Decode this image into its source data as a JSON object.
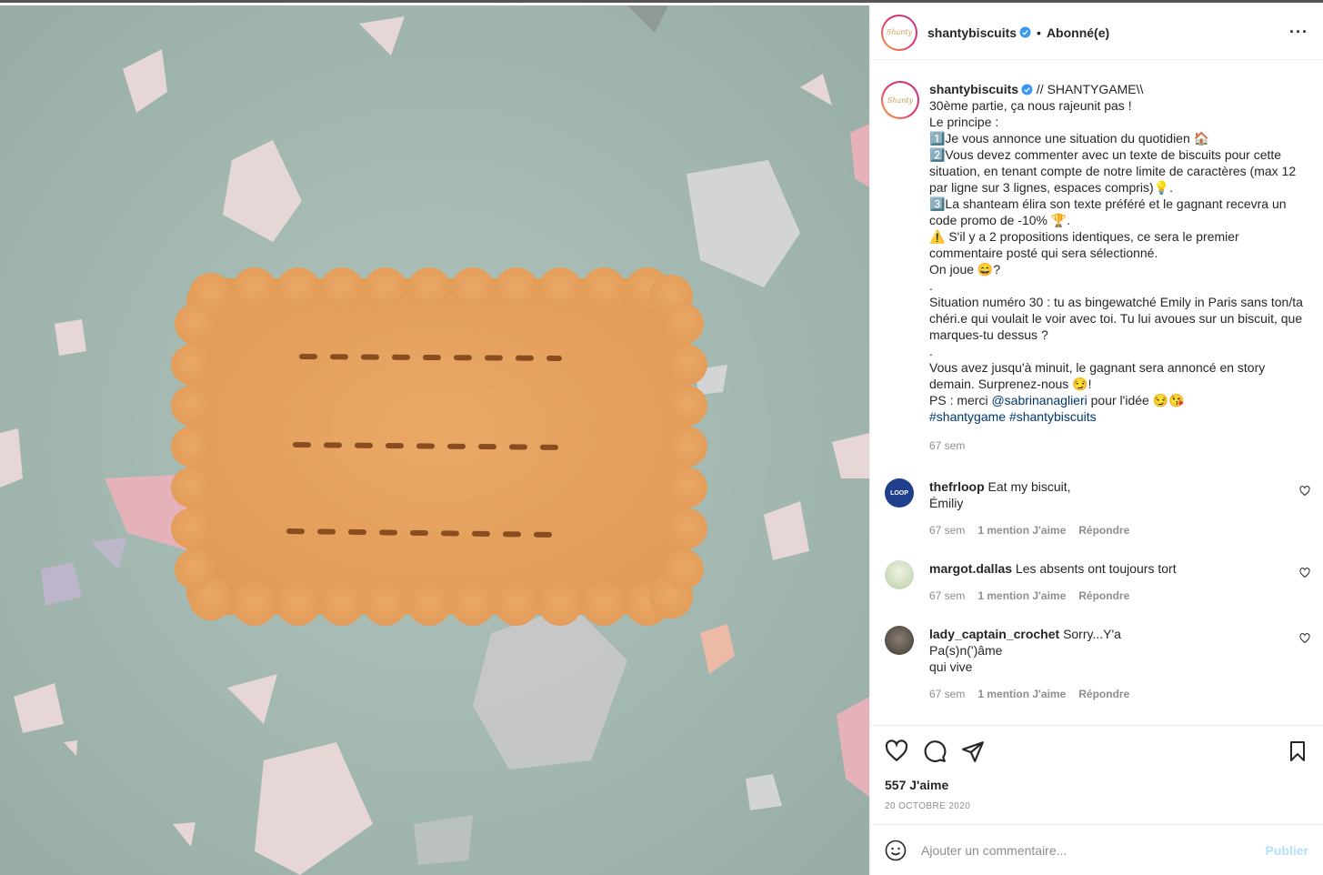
{
  "post": {
    "author": "shantybiscuits",
    "logo_text": "Shanty",
    "follow_status": "Abonné(e)",
    "dot": "•",
    "more": "···",
    "caption_lines": [
      "// SHANTYGAME\\\\",
      "30ème partie, ça nous rajeunit pas !",
      "Le principe :",
      "1️⃣Je vous annonce une situation du quotidien 🏠",
      "2️⃣Vous devez commenter avec un texte de biscuits pour cette situation, en tenant compte de notre limite de caractères (max 12 par ligne sur 3 lignes, espaces compris)💡.",
      "3️⃣La shanteam élira son texte préféré et le gagnant recevra un code promo de -10% 🏆.",
      "⚠️ S'il y a 2 propositions identiques, ce sera le premier commentaire posté qui sera sélectionné.",
      "On joue 😄?",
      ".",
      "Situation numéro 30 : tu as bingewatché Emily in Paris sans ton/ta chéri.e qui voulait le voir avec toi. Tu lui avoues sur un biscuit, que marques-tu dessus ?",
      ".",
      "Vous avez jusqu'à minuit, le gagnant sera annoncé en story demain. Surprenez-nous 😏!"
    ],
    "ps_prefix": "PS : merci ",
    "ps_mention": "@sabrinanaglieri",
    "ps_suffix": " pour l'idée 😏😘",
    "hashtags": "#shantygame #shantybiscuits",
    "caption_age": "67 sem",
    "likes": "557 J'aime",
    "date": "20 OCTOBRE 2020"
  },
  "comments": [
    {
      "user": "thefrloop",
      "text": "Eat my biscuit,\nÉmiliy",
      "age": "67 sem",
      "likes": "1 mention J'aime",
      "reply": "Répondre",
      "avatar_label": "LOOP",
      "avatar_color": "#1f3e8c"
    },
    {
      "user": "margot.dallas",
      "text": "Les absents ont toujours tort",
      "age": "67 sem",
      "likes": "1 mention J'aime",
      "reply": "Répondre",
      "avatar_color": "#d9e6c6"
    },
    {
      "user": "lady_captain_crochet",
      "text": "Sorry...Y'a\nPa(s)n(')âme\nqui vive",
      "age": "67 sem",
      "likes": "1 mention J'aime",
      "reply": "Répondre",
      "avatar_color": "#6b6157"
    }
  ],
  "add_comment": {
    "placeholder": "Ajouter un commentaire...",
    "publish": "Publier"
  },
  "colors": {
    "background": "#a7bdb5",
    "biscuit": "#e8a35f",
    "link": "#00376b",
    "publish": "#b2dffc"
  }
}
